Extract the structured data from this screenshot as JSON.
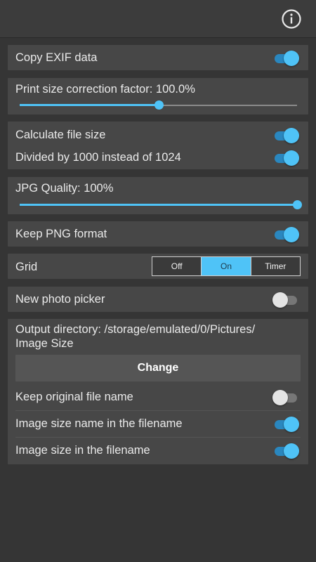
{
  "app": {
    "info_icon": "info-icon"
  },
  "settings": {
    "copy_exif": {
      "label": "Copy EXIF data",
      "enabled": true
    },
    "print_size": {
      "label": "Print size correction factor: 100.0%",
      "value_fraction": 0.5
    },
    "calc_file_size": {
      "label": "Calculate file size",
      "enabled": true
    },
    "divided_1000": {
      "label": "Divided by 1000 instead of 1024",
      "enabled": true
    },
    "jpg_quality": {
      "label": "JPG Quality: 100%",
      "value_fraction": 1.0
    },
    "keep_png": {
      "label": "Keep PNG format",
      "enabled": true
    },
    "grid": {
      "label": "Grid",
      "options": [
        "Off",
        "On",
        "Timer"
      ],
      "selected": "On"
    },
    "new_photo_picker": {
      "label": "New photo picker",
      "enabled": false
    },
    "output": {
      "label_line1": "Output directory: /storage/emulated/0/Pictures/",
      "label_line2": "Image Size",
      "change_label": "Change",
      "keep_original_name": {
        "label": "Keep original file name",
        "enabled": false
      },
      "size_name_in_filename": {
        "label": "Image size name in the filename",
        "enabled": true
      },
      "size_in_filename": {
        "label": "Image size in the filename",
        "enabled": true
      }
    }
  },
  "colors": {
    "accent": "#4fc3f7",
    "background": "#353535",
    "card": "#474747"
  }
}
